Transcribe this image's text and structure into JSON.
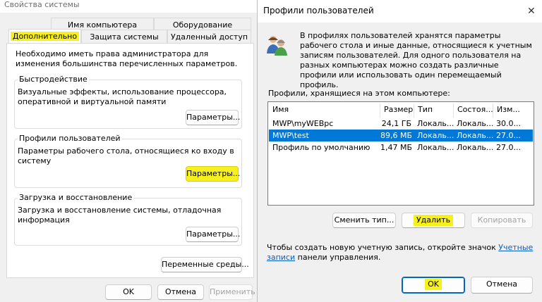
{
  "system_properties": {
    "title": "Свойства системы",
    "tabs": [
      "Имя компьютера",
      "Оборудование",
      "Дополнительно",
      "Защита системы",
      "Удаленный доступ"
    ],
    "admin_note": "Необходимо иметь права администратора для изменения большинства перечисленных параметров.",
    "performance": {
      "title": "Быстродействие",
      "text": "Визуальные эффекты, использование процессора, оперативной и виртуальной памяти",
      "button": "Параметры..."
    },
    "user_profiles": {
      "title": "Профили пользователей",
      "text": "Параметры рабочего стола, относящиеся ко входу в систему",
      "button": "Параметры..."
    },
    "startup_recovery": {
      "title": "Загрузка и восстановление",
      "text": "Загрузка и восстановление системы, отладочная информация",
      "button": "Параметры..."
    },
    "env_button": "Переменные среды...",
    "ok": "OK",
    "cancel": "Отмена",
    "apply": "Применить"
  },
  "user_profiles_dialog": {
    "title": "Профили пользователей",
    "info": "В профилях пользователей хранятся параметры рабочего стола и иные данные, относящиеся к учетным записям пользователей. Для одного пользователя на разных компьютерах можно создать различные профили или использовать один перемещаемый профиль.",
    "list_label": "Профили, хранящиеся на этом компьютере:",
    "columns": [
      "Имя",
      "Размер",
      "Тип",
      "Состоя...",
      "Изм..."
    ],
    "rows": [
      {
        "name": "MWP\\myWEBpc",
        "size": "24,1 ГБ",
        "type": "Локаль...",
        "state": "Локаль...",
        "modified": "30.0..."
      },
      {
        "name": "MWP\\test",
        "size": "89,6 МБ",
        "type": "Локаль...",
        "state": "Локаль...",
        "modified": "27.0..."
      },
      {
        "name": "Профиль по умолчанию",
        "size": "1,47 МБ",
        "type": "Локаль...",
        "state": "Локаль...",
        "modified": "27.0..."
      }
    ],
    "change_type": "Сменить тип...",
    "delete": "Удалить",
    "copy": "Копировать",
    "footer_before": "Чтобы создать новую учетную запись, откройте значок ",
    "footer_link": "Учетные записи",
    "footer_after": " панели управления.",
    "ok": "OK",
    "cancel": "Отмена"
  },
  "colors": {
    "highlight": "#f6f01f",
    "selection": "#0078d7",
    "link": "#0a5ec2"
  },
  "icons": {
    "close": "close-icon",
    "users": "users-icon"
  }
}
